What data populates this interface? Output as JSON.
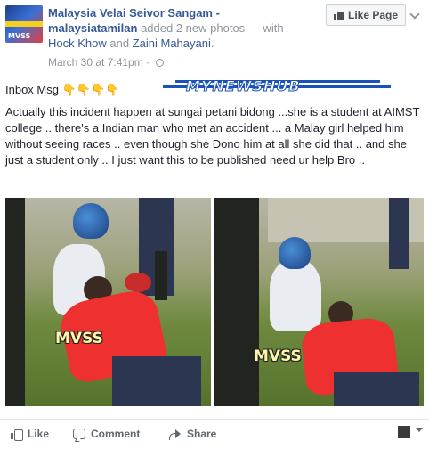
{
  "post": {
    "page_name": "Malaysia Velai Seivor Sangam -",
    "author": "malaysiatamilan",
    "action_text": "added 2 new photos",
    "with_text": "— with",
    "tag1": "Hock Khow",
    "and_text": "and",
    "tag2": "Zaini Mahayani",
    "period": ".",
    "timestamp": "March 30 at 7:41pm",
    "separator": "·",
    "inbox_label": "Inbox Msg ",
    "inbox_emoji": "👇👇👇👇",
    "banner_text": "MYNEWSHUB",
    "body": "Actually this incident happen at sungai petani bidong ...she is a student at AIMST college .. there's a Indian man who met an accident ... a Malay girl helped him without seeing races .. even though she Dono him at all she did that .. and she just a student only .. I just want this to be published need ur help Bro .."
  },
  "header": {
    "like_page_label": "Like Page",
    "avatar_text": "MVSS"
  },
  "photos": [
    {
      "watermark": "MVSS"
    },
    {
      "watermark": "MVSS"
    }
  ],
  "actions": {
    "like": "Like",
    "comment": "Comment",
    "share": "Share"
  },
  "colors": {
    "link": "#365899",
    "muted": "#90949c",
    "text": "#1d2129"
  }
}
